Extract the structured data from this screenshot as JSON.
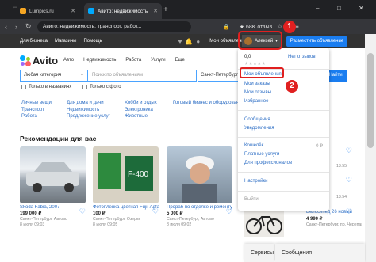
{
  "browser": {
    "tabs": [
      {
        "label": "Lumpics.ru",
        "favicon_color": "#f5a623"
      },
      {
        "label": "Авито: недвижимость",
        "favicon_color": "#00aaff"
      }
    ],
    "new_tab": "+",
    "url": "Авито: недвижимость, транспорт, работ...",
    "extension_badge": "★ 68K отзыв",
    "window_controls": [
      "–",
      "□",
      "✕"
    ]
  },
  "site": {
    "topbar_links": [
      "Для бизнеса",
      "Магазины",
      "Помощь"
    ],
    "my_ads": "Мои объявления",
    "account_name": "Алексей",
    "post_button": "Разместить объявление",
    "logo": "Avito",
    "nav": [
      "Авто",
      "Недвижимость",
      "Работа",
      "Услуги",
      "Еще"
    ],
    "category": "Любая категория",
    "search_placeholder": "Поиск по объявлениям",
    "city": "Санкт-Петербург",
    "find_button": "Найти",
    "checkboxes": [
      "Только в названиях",
      "Только с фото"
    ],
    "columns": [
      [
        "Личные вещи",
        "Транспорт",
        "Работа"
      ],
      [
        "Для дома и дачи",
        "Недвижимость",
        "Предложение услуг"
      ],
      [
        "Хобби и отдых",
        "Электроника",
        "Животные"
      ],
      [
        "Готовый бизнес и оборудование"
      ]
    ],
    "recommendations_title": "Рекомендации для вас",
    "cards": [
      {
        "title": "Skoda Fabia, 2007",
        "price": "199 000 ₽",
        "meta1": "Санкт-Петербург, Автово",
        "meta2": "8 июля 09:03"
      },
      {
        "title": "Фотопленка цветная Fuji, Agfa, Kodak",
        "price": "100 ₽",
        "meta1": "Санкт-Петербург, Озерки",
        "meta2": "8 июля 09:05"
      },
      {
        "title": "Прораб по отделке и ремонту",
        "price": "5 000 ₽",
        "meta1": "Санкт-Петербург, Автово",
        "meta2": "8 июля 09:02"
      }
    ],
    "right_cards": [
      {
        "title": "",
        "meta": "13:55"
      },
      {
        "title": "",
        "meta": "13:54"
      },
      {
        "title": "Велосипед 26 новый",
        "price": "4 990 ₽",
        "meta": "Санкт-Петербург, пр. Черепановых"
      }
    ],
    "bottom_bar": [
      "Сервисы",
      "Сообщения"
    ]
  },
  "dropdown": {
    "rating": "0,0",
    "no_reviews": "Нет отзывов",
    "items_group1": [
      "Мои объявления",
      "Мои заказы",
      "Мои отзывы",
      "Избранное"
    ],
    "items_group2": [
      "Сообщения",
      "Уведомления"
    ],
    "wallet": "Кошелёк",
    "wallet_value": "0 ₽",
    "items_group3": [
      "Платные услуги",
      "Для профессионалов"
    ],
    "settings": "Настройки",
    "logout": "Выйти"
  },
  "annotations": {
    "step1": "1",
    "step2": "2",
    "color": "#e02020"
  }
}
